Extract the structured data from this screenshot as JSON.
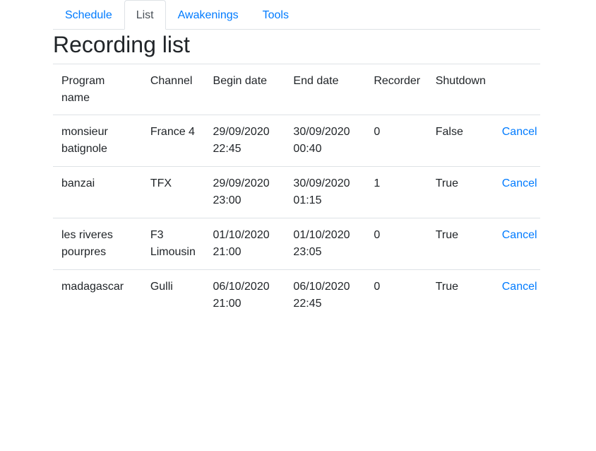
{
  "tabs": [
    {
      "label": "Schedule",
      "active": false
    },
    {
      "label": "List",
      "active": true
    },
    {
      "label": "Awakenings",
      "active": false
    },
    {
      "label": "Tools",
      "active": false
    }
  ],
  "page_title": "Recording list",
  "table": {
    "headers": [
      "Program name",
      "Channel",
      "Begin date",
      "End date",
      "Recorder",
      "Shutdown",
      ""
    ],
    "rows": [
      {
        "program": "monsieur batignole",
        "channel": "France 4",
        "begin": "29/09/2020 22:45",
        "end": "30/09/2020 00:40",
        "recorder": "0",
        "shutdown": "False",
        "action": "Cancel"
      },
      {
        "program": "banzai",
        "channel": "TFX",
        "begin": "29/09/2020 23:00",
        "end": "30/09/2020 01:15",
        "recorder": "1",
        "shutdown": "True",
        "action": "Cancel"
      },
      {
        "program": "les riveres pourpres",
        "channel": "F3 Limousin",
        "begin": "01/10/2020 21:00",
        "end": "01/10/2020 23:05",
        "recorder": "0",
        "shutdown": "True",
        "action": "Cancel"
      },
      {
        "program": "madagascar",
        "channel": "Gulli",
        "begin": "06/10/2020 21:00",
        "end": "06/10/2020 22:45",
        "recorder": "0",
        "shutdown": "True",
        "action": "Cancel"
      }
    ]
  },
  "colors": {
    "link": "#007bff",
    "text": "#212529",
    "border": "#dee2e6",
    "active_tab_text": "#495057"
  }
}
